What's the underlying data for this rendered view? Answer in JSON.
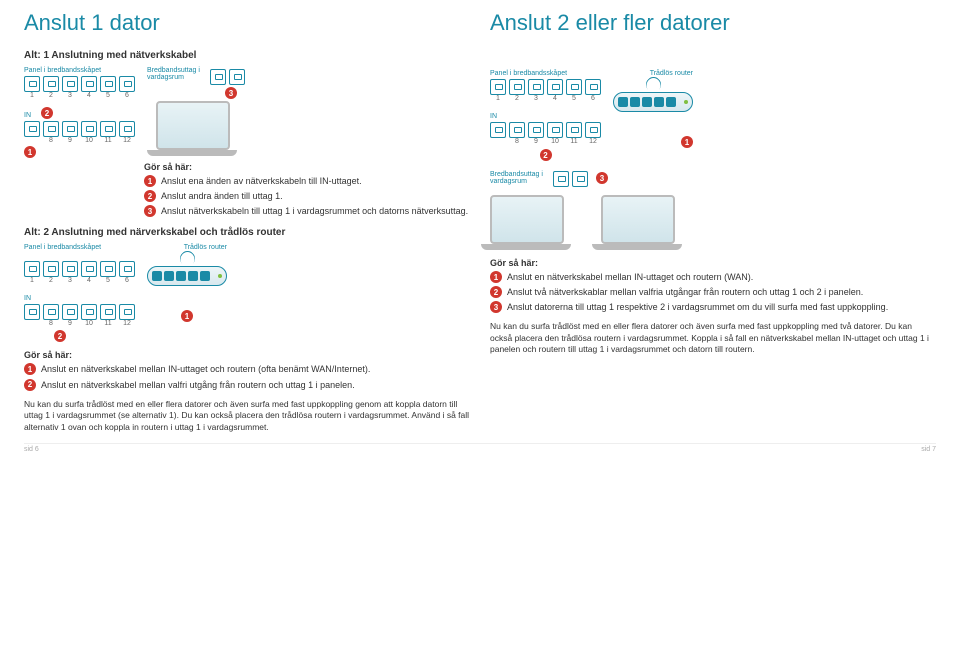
{
  "left": {
    "heading": "Anslut 1 dator",
    "alt1_title": "Alt: 1 Anslutning med nätverkskabel",
    "panel_label": "Panel i bredbandsskåpet",
    "outlet_label": "Bredbandsuttag i vardagsrum",
    "ports_upper": [
      "1",
      "2",
      "3",
      "4",
      "5",
      "6"
    ],
    "in_label": "IN",
    "ports_lower": [
      "8",
      "9",
      "10",
      "11",
      "12"
    ],
    "do_title": "Gör så här:",
    "steps_alt1": [
      "Anslut ena änden av nätverkskabeln till IN-uttaget.",
      "Anslut andra änden till uttag 1.",
      "Anslut nätverkskabeln till uttag 1 i vardagsrummet och datorns nätverksuttag."
    ],
    "alt2_title": "Alt: 2 Anslutning med närverkskabel och trådlös router",
    "router_label": "Trådlös router",
    "steps_alt2": [
      "Anslut en nätverkskabel mellan IN-uttaget och routern (ofta benämt WAN/Internet).",
      "Anslut en nätverkskabel mellan valfri utgång från routern och uttag 1 i panelen."
    ],
    "note": "Nu kan du surfa trådlöst med en eller flera datorer och även surfa med fast uppkoppling genom att koppla datorn till uttag 1 i vardagsrummet (se alternativ 1). Du kan också placera den trådlösa routern i vardagsrummet. Använd i så fall alternativ 1 ovan och koppla in routern i uttag 1 i vardagsrummet.",
    "pagenum": "sid 6"
  },
  "right": {
    "heading": "Anslut 2 eller fler datorer",
    "panel_label": "Panel i bredbandsskåpet",
    "router_label": "Trådlös router",
    "ports_upper": [
      "1",
      "2",
      "3",
      "4",
      "5",
      "6"
    ],
    "in_label": "IN",
    "ports_lower": [
      "8",
      "9",
      "10",
      "11",
      "12"
    ],
    "outlet_label": "Bredbandsuttag i vardagsrum",
    "do_title": "Gör så här:",
    "steps": [
      "Anslut en nätverkskabel mellan IN-uttaget och routern (WAN).",
      "Anslut två nätverkskablar mellan valfria utgångar från routern och uttag 1 och 2 i panelen.",
      "Anslut datorerna till uttag 1 respektive 2 i vardagsrummet om du vill surfa med fast uppkoppling."
    ],
    "note": "Nu kan du surfa trådlöst med en eller flera datorer och även surfa med fast uppkoppling med två datorer. Du kan också placera den trådlösa routern i vardagsrummet. Koppla i så fall en nätverkskabel mellan IN-uttaget och uttag 1 i panelen och routern till uttag 1 i vardagsrummet och datorn till routern.",
    "pagenum": "sid 7"
  }
}
